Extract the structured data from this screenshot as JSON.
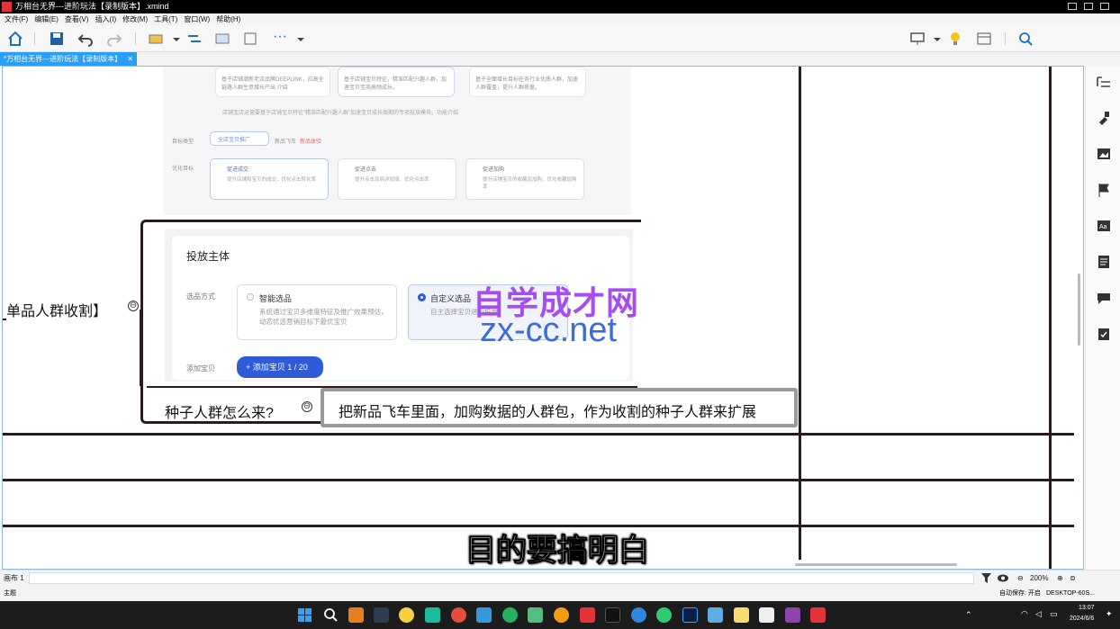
{
  "window": {
    "title": "万相台无界---进阶玩法【录制版本】.xmind"
  },
  "menu": [
    "文件(F)",
    "编辑(E)",
    "查看(V)",
    "插入(I)",
    "修改(M)",
    "工具(T)",
    "窗口(W)",
    "帮助(H)"
  ],
  "toolbar": {
    "more_label": "···"
  },
  "tab": {
    "label": "*万相台无界---进阶玩法【录制版本】",
    "close": "✕"
  },
  "mindmap": {
    "parent_topic": "单品人群收割】",
    "child_topic": "种子人群怎么来?",
    "callout_text": "把新品飞车里面，加购数据的人群包，作为收割的种子人群来扩展",
    "collapse_symbol": "⊖"
  },
  "embedded_screenshot": {
    "top_hint": "店铺宝店运营要基于店铺宝贝特征“精准匹配兴趣人群”加速宝贝成长周期的专项投放模块。功能介绍",
    "target_type_label": "目标类型",
    "target_options": [
      "全店宝贝推广",
      "新品飞车"
    ],
    "new_badge": "新品体验",
    "opt_goal_label": "优化目标",
    "goals": [
      {
        "title": "促进成交",
        "desc": "提升店铺和宝贝的成交，优化点击转化率"
      },
      {
        "title": "促进点击",
        "desc": "提升点击及商详加填，优化点击率"
      },
      {
        "title": "促进加购",
        "desc": "提升店铺宝贝的收藏及加购，优化收藏加购率"
      }
    ],
    "card_texts": [
      "基于店铺潮新老流品牌DEEPLINK，拉高全链路人群生意增长产出 介绍",
      "基于店铺宝贝特征，精准匹配兴趣人群，加速宝贝宝商高频成长。",
      "基于全面增长目标任务行业优质人群，加速人群覆盖，提升人群质量。"
    ],
    "section_title": "投放主体",
    "select_mode_label": "选品方式",
    "smart_title": "智能选品",
    "smart_desc": "系统通过宝贝多维度特征及推广效果预估，动态优选营销目标下最优宝贝",
    "custom_title": "自定义选品",
    "custom_desc": "自主选择宝贝进行投放",
    "add_label": "添加宝贝",
    "add_button": "+ 添加宝贝 1 / 20"
  },
  "watermark": {
    "line1": "自学成才网",
    "line2": "zx-cc.net"
  },
  "subtitle": "目的要搞明白",
  "status": {
    "sheet": "画布 1",
    "zoom": "200%",
    "auto_save": "自动保存: 开启",
    "computer": "DESKTOP-60S...",
    "bottom_left": "主题"
  },
  "clock": {
    "time": "13:07",
    "date": "2024/6/6"
  },
  "colors": {
    "accent": "#2a9df4",
    "line": "#2b1a22",
    "watermark_purple": "#a54df0",
    "watermark_blue": "#3b6dd9",
    "primary_btn": "#2f5bd8"
  }
}
